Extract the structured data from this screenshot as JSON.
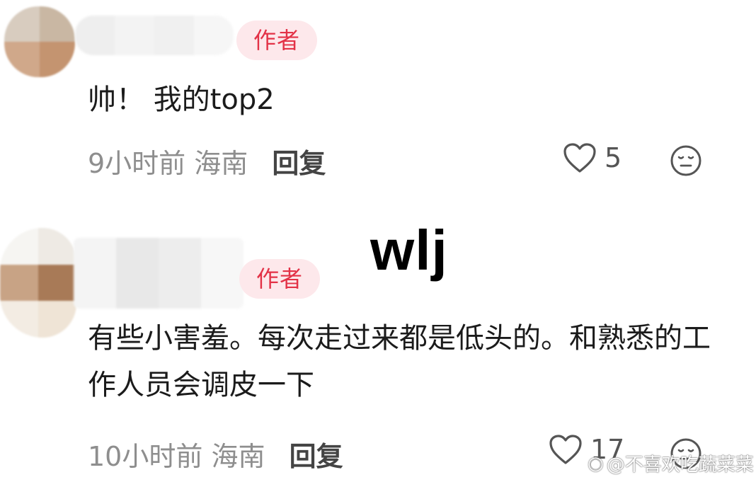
{
  "comments": [
    {
      "badge": "作者",
      "text": "帅！ 我的top2",
      "time": "9小时前",
      "location": "海南",
      "reply_label": "回复",
      "likes": "5"
    },
    {
      "badge": "作者",
      "text": "有些小害羞。每次走过来都是低头的。和熟悉的工作人员会调皮一下",
      "time": "10小时前",
      "location": "海南",
      "reply_label": "回复",
      "likes": "17"
    }
  ],
  "overlay": {
    "text": "wlj"
  },
  "watermark": {
    "text": "@不喜欢吃蔬菜菜"
  },
  "colors": {
    "badge_bg": "#fde8eb",
    "badge_text": "#e33247",
    "meta": "#8e8e8e"
  },
  "icons": [
    "heart-icon",
    "neutral-face-icon",
    "weibo-logo-icon"
  ]
}
